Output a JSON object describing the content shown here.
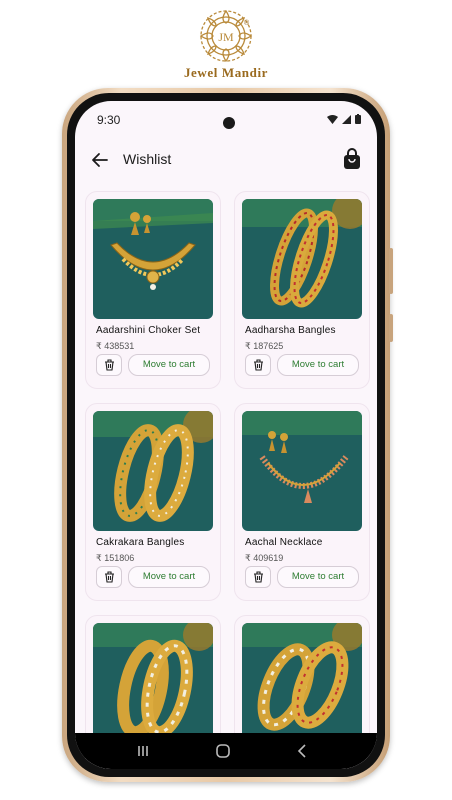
{
  "brand": {
    "name": "Jewel Mandir",
    "monogram": "JM"
  },
  "status_bar": {
    "time": "9:30"
  },
  "header": {
    "title": "Wishlist"
  },
  "wishlist": [
    {
      "name": "Aadarshini Choker Set",
      "price": "₹ 438531",
      "action": "Move to cart"
    },
    {
      "name": "Aadharsha Bangles",
      "price": "₹ 187625",
      "action": "Move to cart"
    },
    {
      "name": "Cakrakara Bangles",
      "price": "₹ 151806",
      "action": "Move to cart"
    },
    {
      "name": "Aachal Necklace",
      "price": "₹ 409619",
      "action": "Move to cart"
    },
    {
      "name": "",
      "price": "",
      "action": ""
    },
    {
      "name": "",
      "price": "",
      "action": ""
    }
  ],
  "colors": {
    "accent": "#2e7d32",
    "gold": "#c9962a",
    "teal": "#1b5a5a",
    "brand": "#9a6a1e"
  }
}
